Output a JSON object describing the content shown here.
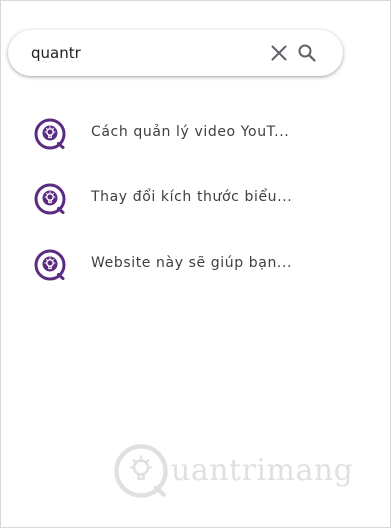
{
  "search": {
    "value": "quantr",
    "clear_icon": "close-icon",
    "search_icon": "search-icon"
  },
  "results": [
    {
      "label": "Cách quản lý video YouT...",
      "icon": "quantrimang-logo-icon"
    },
    {
      "label": "Thay đổi kích thước biểu...",
      "icon": "quantrimang-logo-icon"
    },
    {
      "label": "Website này sẽ giúp bạn...",
      "icon": "quantrimang-logo-icon"
    }
  ],
  "watermark": {
    "text": "uantrimang"
  },
  "colors": {
    "brand_purple": "#5b2b82",
    "icon_gray": "#5f6368",
    "text": "#3c4043"
  }
}
